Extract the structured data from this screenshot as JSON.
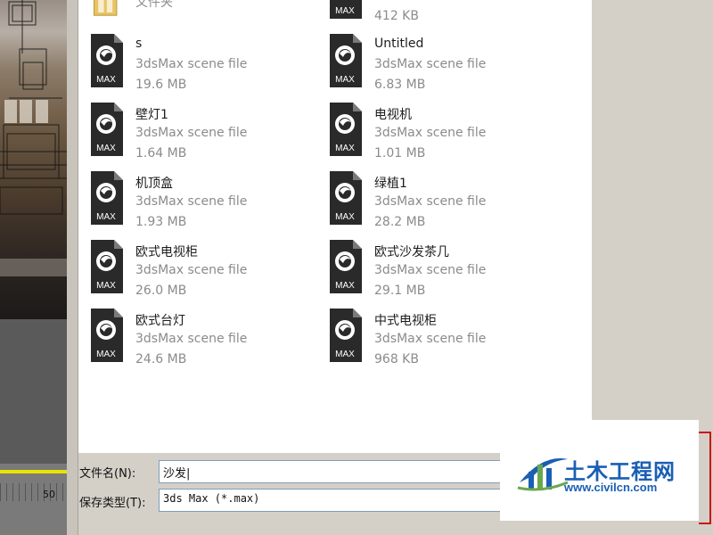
{
  "viewport": {
    "timeline_number": "50"
  },
  "files_left": [
    {
      "name": "文件夹",
      "type": "",
      "size": ""
    },
    {
      "name": "s",
      "type": "3dsMax scene file",
      "size": "19.6 MB"
    },
    {
      "name": "壁灯1",
      "type": "3dsMax scene file",
      "size": "1.64 MB"
    },
    {
      "name": "机顶盒",
      "type": "3dsMax scene file",
      "size": "1.93 MB"
    },
    {
      "name": "欧式电视柜",
      "type": "3dsMax scene file",
      "size": "26.0 MB"
    },
    {
      "name": "欧式台灯",
      "type": "3dsMax scene file",
      "size": "24.6 MB"
    }
  ],
  "files_right": [
    {
      "name": "",
      "type": "",
      "size": "412 KB"
    },
    {
      "name": "Untitled",
      "type": "3dsMax scene file",
      "size": "6.83 MB"
    },
    {
      "name": "电视机",
      "type": "3dsMax scene file",
      "size": "1.01 MB"
    },
    {
      "name": "绿植1",
      "type": "3dsMax scene file",
      "size": "28.2 MB"
    },
    {
      "name": "欧式沙发茶几",
      "type": "3dsMax scene file",
      "size": "29.1 MB"
    },
    {
      "name": "中式电视柜",
      "type": "3dsMax scene file",
      "size": "968 KB"
    }
  ],
  "icon_label": "MAX",
  "filename": {
    "label": "文件名(N):",
    "value": "沙发|"
  },
  "filetype": {
    "label": "保存类型(T):",
    "value": "3ds Max (*.max)"
  },
  "watermark": {
    "brand": "土木工程网",
    "url": "www.civilcn.com"
  },
  "colors": {
    "icon_dark": "#2a2a2a",
    "watermark_blue": "#1a5fb4",
    "highlight_red": "#d01010"
  }
}
